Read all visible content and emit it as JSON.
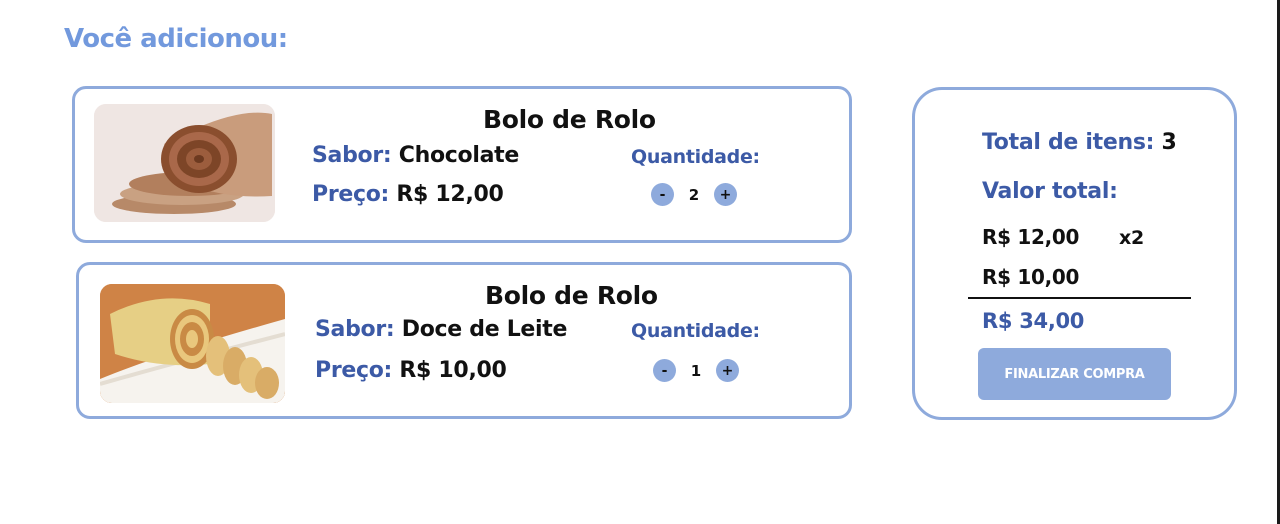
{
  "page": {
    "title": "Você adicionou:"
  },
  "cart": {
    "items": [
      {
        "name": "Bolo de Rolo",
        "flavor_label": "Sabor:",
        "flavor": "Chocolate",
        "price_label": "Preço:",
        "price": "R$ 12,00",
        "quantity_label": "Quantidade:",
        "quantity": "2",
        "decrement": "-",
        "increment": "+",
        "image": "chocolate-roll-cake"
      },
      {
        "name": "Bolo de Rolo",
        "flavor_label": "Sabor:",
        "flavor": "Doce de Leite",
        "price_label": "Preço:",
        "price": "R$ 10,00",
        "quantity_label": "Quantidade:",
        "quantity": "1",
        "decrement": "-",
        "increment": "+",
        "image": "doce-de-leite-roll-cake"
      }
    ]
  },
  "summary": {
    "total_items_label": "Total de itens:",
    "total_items": "3",
    "total_value_label": "Valor total:",
    "lines": [
      {
        "price": "R$ 12,00",
        "multiplier": "x2"
      },
      {
        "price": "R$ 10,00",
        "multiplier": ""
      }
    ],
    "grand_total": "R$ 34,00",
    "checkout_label": "FINALIZAR COMPRA"
  },
  "colors": {
    "accent": "#8eaadc",
    "title": "#7299dd",
    "label": "#3c5aa6",
    "text": "#111111"
  }
}
